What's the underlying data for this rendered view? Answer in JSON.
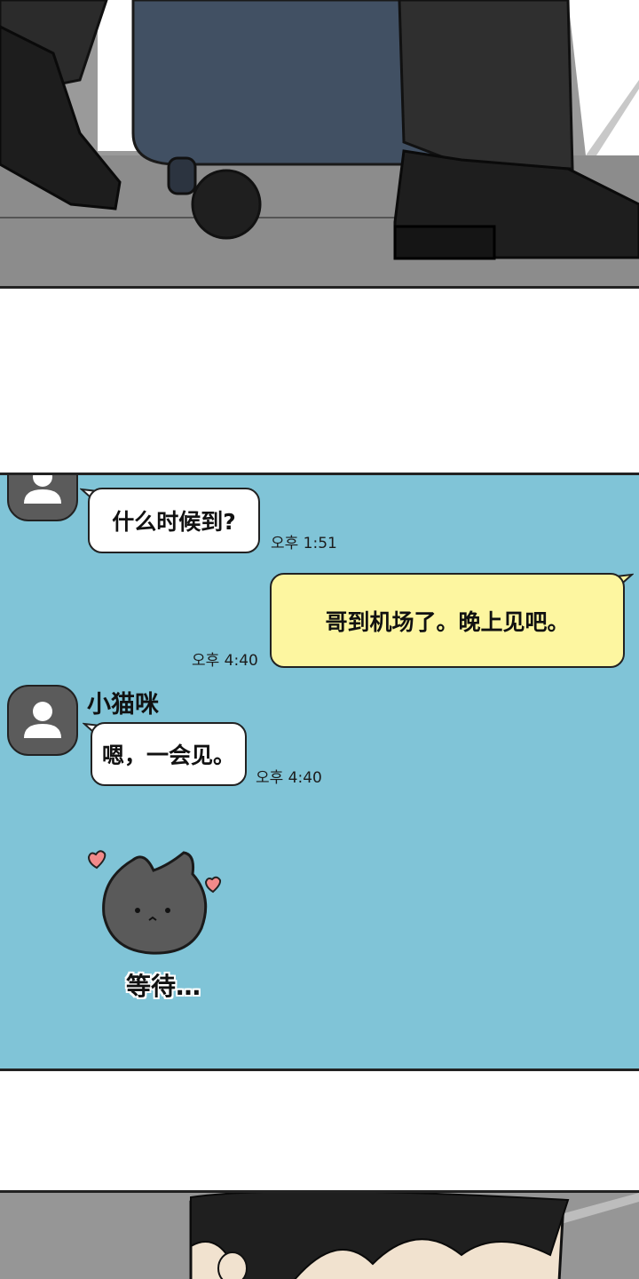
{
  "chat": {
    "messages": [
      {
        "sender": "",
        "text": "什么时候到?",
        "time": "오후 1:51"
      },
      {
        "sender": "me",
        "text": "哥到机场了。晚上见吧。",
        "time": "오후 4:40"
      },
      {
        "sender": "小猫咪",
        "text": "嗯，一会见。",
        "time": "오후 4:40"
      }
    ],
    "sticker_caption": "等待…"
  },
  "colors": {
    "chat_background": "#80c4d7",
    "incoming_bubble": "#ffffff",
    "outgoing_bubble": "#fdf6a0",
    "avatar": "#5b5b5b",
    "heart": "#f28a8a",
    "cat": "#5a5a5a"
  },
  "icons": [
    "user-avatar-icon",
    "heart-icon",
    "cat-sticker-icon"
  ]
}
